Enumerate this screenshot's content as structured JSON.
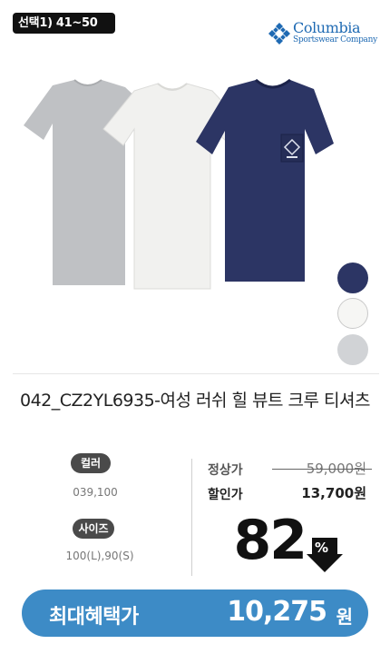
{
  "badge": {
    "text": "선택1) 41~50"
  },
  "brand": {
    "name": "Columbia",
    "subtitle": "Sportswear Company",
    "color": "#1f6ab3"
  },
  "product": {
    "title": "042_CZ2YL6935-여성 러쉬 힐 뷰트 크루 티셔츠",
    "image_icon": "tshirt-product-image",
    "swatches": [
      {
        "name": "navy",
        "color": "#2c3564"
      },
      {
        "name": "white",
        "color": "#f6f6f4"
      },
      {
        "name": "gray",
        "color": "#d1d3d6"
      }
    ]
  },
  "options": {
    "color_label": "컬러",
    "color_value": "039,100",
    "size_label": "사이즈",
    "size_value": "100(L),90(S)"
  },
  "price": {
    "regular_label": "정상가",
    "regular_value": "59,000원",
    "sale_label": "할인가",
    "sale_value": "13,700원",
    "discount_rate": "82",
    "discount_symbol": "%"
  },
  "benefit": {
    "label": "최대혜택가",
    "value": "10,275",
    "unit": "원",
    "color": "#3d8bc6"
  }
}
